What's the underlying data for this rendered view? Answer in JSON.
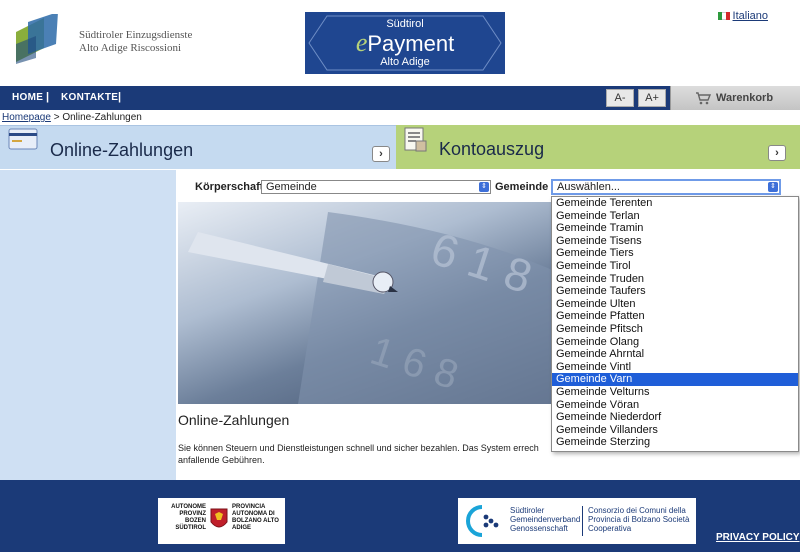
{
  "header": {
    "logo_line1": "Südtiroler Einzugsdienste",
    "logo_line2": "Alto Adige Riscossioni",
    "epay_top": "Südtirol",
    "epay_main": "Payment",
    "epay_e": "e",
    "epay_bottom": "Alto Adige",
    "language": "Italiano"
  },
  "nav": {
    "home": "HOME",
    "contacts": "KONTAKTE",
    "sep": "|",
    "font_smaller": "A-",
    "font_larger": "A+",
    "cart": "Warenkorb"
  },
  "breadcrumb": {
    "home": "Homepage",
    "separator": " > ",
    "current": "Online-Zahlungen"
  },
  "banners": {
    "left_title": "Online-Zahlungen",
    "right_title": "Kontoauszug",
    "arrow": "›"
  },
  "filters": {
    "body_label": "Körperschaft",
    "body_value": "Gemeinde",
    "municipality_label": "Gemeinde",
    "municipality_value": "Auswählen..."
  },
  "dropdown": {
    "items": [
      "Gemeinde Terenten",
      "Gemeinde Terlan",
      "Gemeinde Tramin",
      "Gemeinde Tisens",
      "Gemeinde Tiers",
      "Gemeinde Tirol",
      "Gemeinde Truden",
      "Gemeinde Taufers",
      "Gemeinde Ulten",
      "Gemeinde Pfatten",
      "Gemeinde Pfitsch",
      "Gemeinde Olang",
      "Gemeinde Ahrntal",
      "Gemeinde Vintl",
      "Gemeinde Varn",
      "Gemeinde Velturns",
      "Gemeinde Vöran",
      "Gemeinde Niederdorf",
      "Gemeinde Villanders",
      "Gemeinde Sterzing"
    ],
    "selected_index": 14
  },
  "main": {
    "title": "Online-Zahlungen",
    "description": "Sie können Steuern und Dienstleistungen schnell und sicher bezahlen. Das System errech anfallende Gebühren."
  },
  "footer": {
    "province_de": "AUTONOME PROVINZ BOZEN SÜDTIROL",
    "province_it": "PROVINCIA AUTONOMA DI BOLZANO ALTO ADIGE",
    "consortium_de": "Südtiroler Gemeindenverband Genossenschaft",
    "consortium_it": "Consorzio dei Comuni della Provincia di Bolzano Società Cooperativa",
    "privacy": "PRIVACY POLICY"
  },
  "colors": {
    "navy": "#1b3a78",
    "light_blue": "#c5daf0",
    "green": "#b6d27a",
    "selected": "#1f5ed8"
  }
}
